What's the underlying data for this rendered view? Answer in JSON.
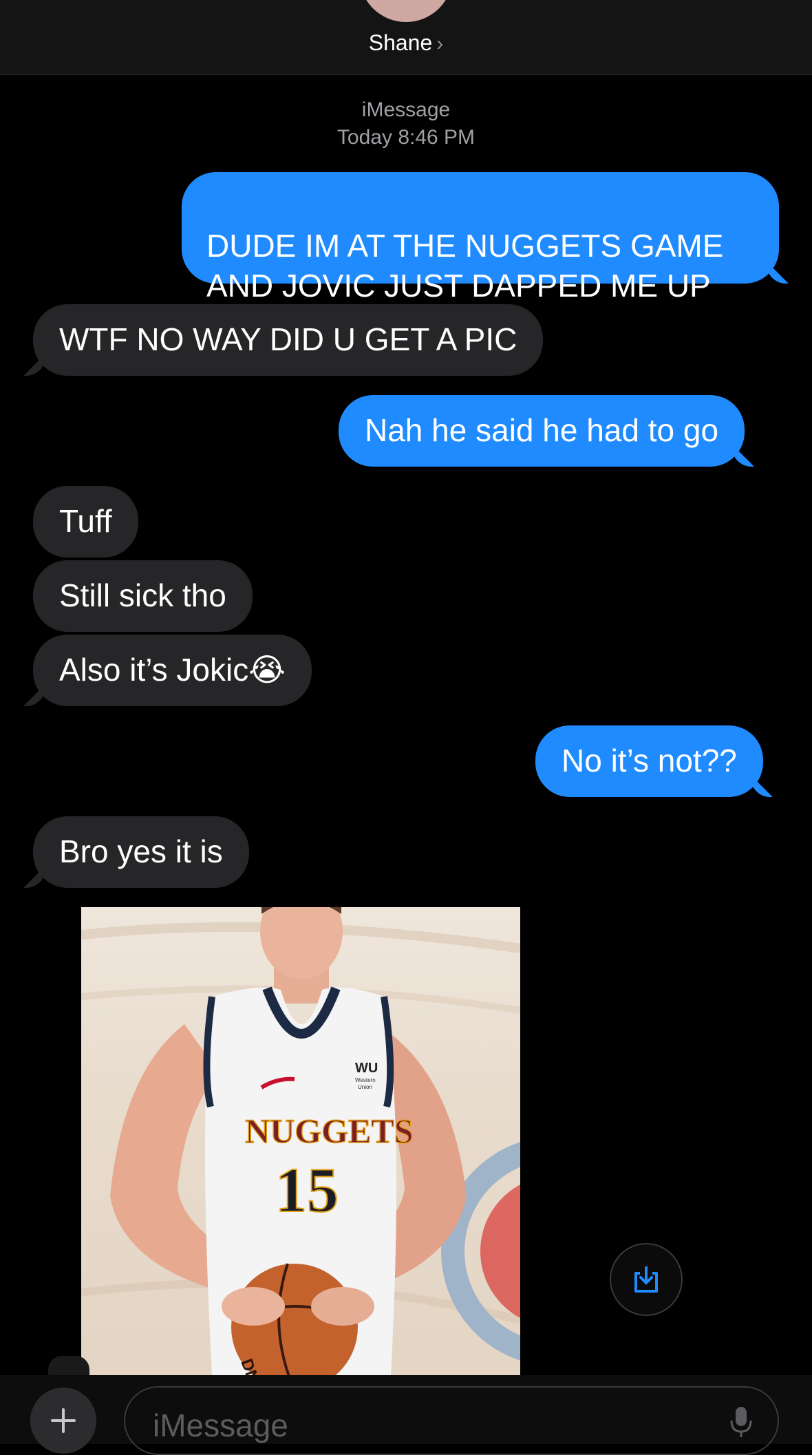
{
  "header": {
    "contact_name": "Shane",
    "chevron": "›"
  },
  "timestamp": {
    "service": "iMessage",
    "day": "Today",
    "time": "8:46 PM"
  },
  "messages": [
    {
      "from": "me",
      "text": "DUDE IM AT THE NUGGETS GAME\nAND JOVIC JUST DAPPED ME UP"
    },
    {
      "from": "them",
      "text": "WTF NO WAY DID U GET A PIC"
    },
    {
      "from": "me",
      "text": "Nah he said he had to go"
    },
    {
      "from": "them",
      "text": "Tuff"
    },
    {
      "from": "them",
      "text": "Still sick tho"
    },
    {
      "from": "them",
      "text": "Also it’s Jokic😭"
    },
    {
      "from": "me",
      "text": "No it’s not??"
    },
    {
      "from": "them",
      "text": "Bro yes it is"
    }
  ],
  "photo": {
    "jersey_text": "NUGGETS",
    "jersey_number": "15",
    "sponsor_logo": "WU",
    "sponsor_line1": "Western",
    "sponsor_line2": "Union",
    "ball_text": "DNG"
  },
  "composer": {
    "placeholder": "iMessage"
  },
  "icons": {
    "save": "download-to-device-icon",
    "add": "plus-icon",
    "mic": "microphone-icon"
  },
  "colors": {
    "sent_bubble": "#1f8bff",
    "received_bubble": "#262628",
    "background": "#000000"
  }
}
